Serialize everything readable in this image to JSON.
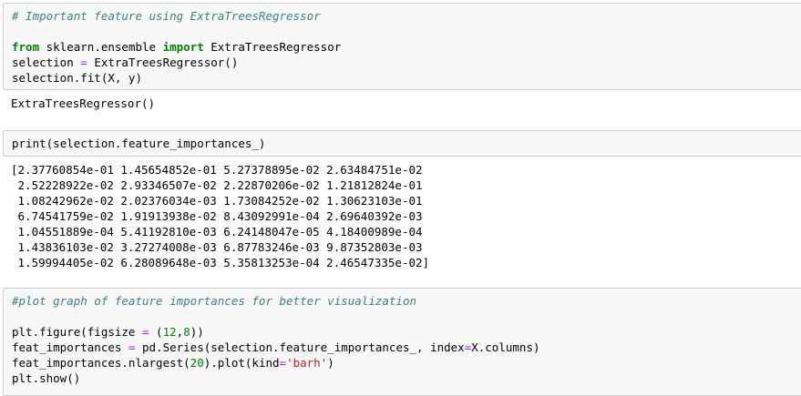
{
  "cells": [
    {
      "type": "code",
      "lines": [
        {
          "tokens": [
            {
              "t": "# Important feature using ExtraTreesRegressor",
              "c": "cm"
            }
          ]
        },
        {
          "tokens": []
        },
        {
          "tokens": [
            {
              "t": "from",
              "c": "kw"
            },
            {
              "t": " sklearn.ensemble ",
              "c": ""
            },
            {
              "t": "import",
              "c": "kw"
            },
            {
              "t": " ExtraTreesRegressor",
              "c": ""
            }
          ]
        },
        {
          "tokens": [
            {
              "t": "selection ",
              "c": ""
            },
            {
              "t": "=",
              "c": "op"
            },
            {
              "t": " ExtraTreesRegressor()",
              "c": ""
            }
          ]
        },
        {
          "tokens": [
            {
              "t": "selection.fit(X, y)",
              "c": ""
            }
          ]
        }
      ],
      "output": [
        "ExtraTreesRegressor()"
      ]
    },
    {
      "type": "code",
      "lines": [
        {
          "tokens": [
            {
              "t": "print",
              "c": ""
            },
            {
              "t": "(selection.feature_importances_)",
              "c": ""
            }
          ]
        }
      ],
      "output": [
        "[2.37760854e-01 1.45654852e-01 5.27378895e-02 2.63484751e-02",
        " 2.52228922e-02 2.93346507e-02 2.22870206e-02 1.21812824e-01",
        " 1.08242962e-02 2.02376034e-03 1.73084252e-02 1.30623103e-01",
        " 6.74541759e-02 1.91913938e-02 8.43092991e-04 2.69640392e-03",
        " 1.04551889e-04 5.41192810e-03 6.24148047e-05 4.18400989e-04",
        " 1.43836103e-02 3.27274008e-03 6.87783246e-03 9.87352803e-03",
        " 1.59994405e-02 6.28089648e-03 5.35813253e-04 2.46547335e-02]"
      ]
    },
    {
      "type": "code",
      "lines": [
        {
          "tokens": [
            {
              "t": "#plot graph of feature importances for better visualization",
              "c": "cm"
            }
          ]
        },
        {
          "tokens": []
        },
        {
          "tokens": [
            {
              "t": "plt.figure(figsize ",
              "c": ""
            },
            {
              "t": "=",
              "c": "op"
            },
            {
              "t": " (",
              "c": ""
            },
            {
              "t": "12",
              "c": "num"
            },
            {
              "t": ",",
              "c": ""
            },
            {
              "t": "8",
              "c": "num"
            },
            {
              "t": "))",
              "c": ""
            }
          ]
        },
        {
          "tokens": [
            {
              "t": "feat_importances ",
              "c": ""
            },
            {
              "t": "=",
              "c": "op"
            },
            {
              "t": " pd.Series(selection.feature_importances_, index",
              "c": ""
            },
            {
              "t": "=",
              "c": "op"
            },
            {
              "t": "X.columns)",
              "c": ""
            }
          ]
        },
        {
          "tokens": [
            {
              "t": "feat_importances.nlargest(",
              "c": ""
            },
            {
              "t": "20",
              "c": "num"
            },
            {
              "t": ").plot(kind",
              "c": ""
            },
            {
              "t": "=",
              "c": "op"
            },
            {
              "t": "'barh'",
              "c": "str"
            },
            {
              "t": ")",
              "c": ""
            }
          ]
        },
        {
          "tokens": [
            {
              "t": "plt.show()",
              "c": ""
            }
          ]
        }
      ]
    }
  ]
}
